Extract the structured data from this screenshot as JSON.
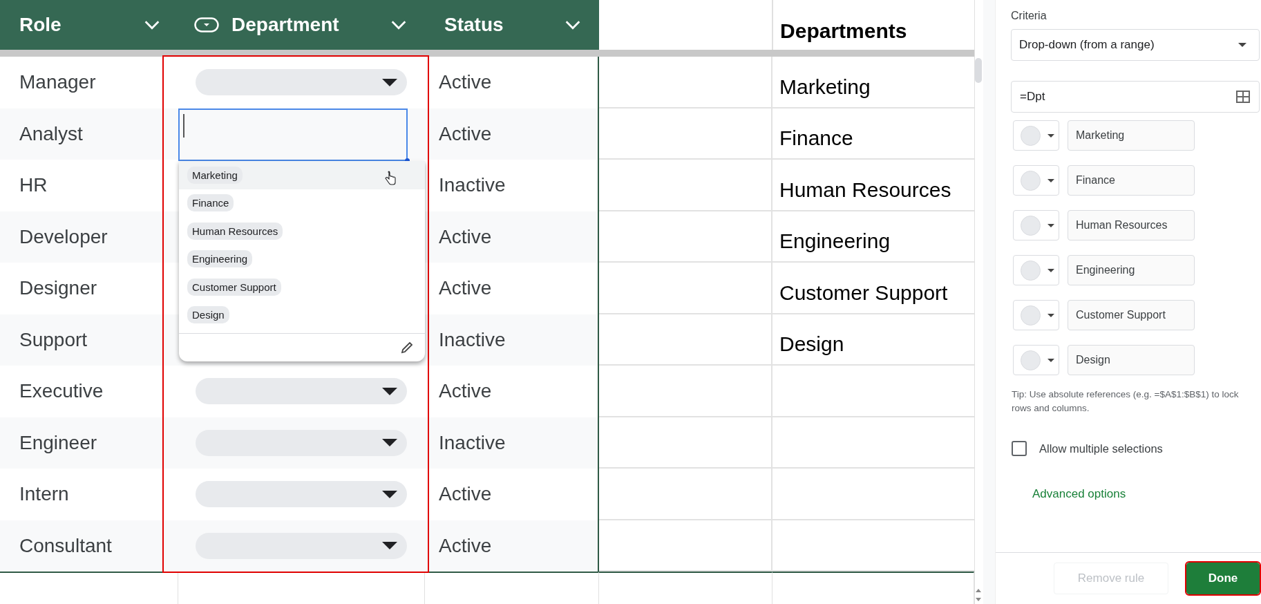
{
  "table": {
    "columns": [
      {
        "label": "Role",
        "type_icon": false,
        "highlighted": false
      },
      {
        "label": "Department",
        "type_icon": true,
        "highlighted": true
      },
      {
        "label": "Status",
        "type_icon": false,
        "highlighted": false
      }
    ],
    "rows": [
      {
        "role": "Manager",
        "editing": false,
        "status": "Active"
      },
      {
        "role": "Analyst",
        "editing": true,
        "status": "Active"
      },
      {
        "role": "HR",
        "editing": false,
        "status": "Inactive"
      },
      {
        "role": "Developer",
        "editing": false,
        "status": "Active"
      },
      {
        "role": "Designer",
        "editing": false,
        "status": "Active"
      },
      {
        "role": "Support",
        "editing": false,
        "status": "Inactive"
      },
      {
        "role": "Executive",
        "editing": false,
        "status": "Active"
      },
      {
        "role": "Engineer",
        "editing": false,
        "status": "Inactive"
      },
      {
        "role": "Intern",
        "editing": false,
        "status": "Active"
      },
      {
        "role": "Consultant",
        "editing": false,
        "status": "Active"
      }
    ]
  },
  "dropdown_menu": {
    "options": [
      {
        "label": "Marketing",
        "hovered": true
      },
      {
        "label": "Finance",
        "hovered": false
      },
      {
        "label": "Human Resources",
        "hovered": false
      },
      {
        "label": "Engineering",
        "hovered": false
      },
      {
        "label": "Customer Support",
        "hovered": false
      },
      {
        "label": "Design",
        "hovered": false
      }
    ]
  },
  "departments_list": {
    "title": "Departments",
    "items": [
      "Marketing",
      "Finance",
      "Human Resources",
      "Engineering",
      "Customer Support",
      "Design"
    ]
  },
  "rule_panel": {
    "criteria_label": "Criteria",
    "criteria_value": "Drop-down (from a range)",
    "range": "=Dpt",
    "items": [
      "Marketing",
      "Finance",
      "Human Resources",
      "Engineering",
      "Customer Support",
      "Design"
    ],
    "tip": "Tip: Use absolute references (e.g. =$A$1:$B$1) to lock rows and columns.",
    "allow_multiple": {
      "label": "Allow multiple selections",
      "checked": false
    },
    "advanced_link": "Advanced options",
    "buttons": [
      {
        "label": "Remove rule",
        "kind": "secondary",
        "disabled": true,
        "highlighted": false
      },
      {
        "label": "Done",
        "kind": "primary",
        "disabled": false,
        "highlighted": true
      }
    ]
  }
}
